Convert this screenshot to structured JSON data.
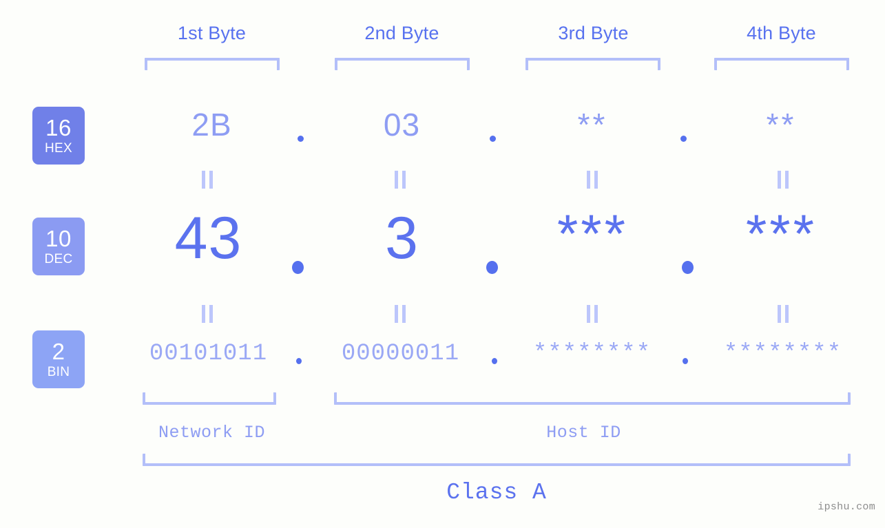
{
  "headers": [
    {
      "label": "1st Byte"
    },
    {
      "label": "2nd Byte"
    },
    {
      "label": "3rd Byte"
    },
    {
      "label": "4th Byte"
    }
  ],
  "rows": [
    {
      "base": "16",
      "base_abbr": "HEX",
      "badge_color": "#7080e8",
      "values": [
        "2B",
        "03",
        "**",
        "**"
      ],
      "separator": "."
    },
    {
      "base": "10",
      "base_abbr": "DEC",
      "badge_color": "#8b9bf2",
      "values": [
        "43",
        "3",
        "***",
        "***"
      ],
      "separator": "."
    },
    {
      "base": "2",
      "base_abbr": "BIN",
      "badge_color": "#8da4f5",
      "values": [
        "00101011",
        "00000011",
        "********",
        "********"
      ],
      "separator": "."
    }
  ],
  "equality_symbol": "||",
  "sections": {
    "network_id": "Network ID",
    "host_id": "Host ID",
    "class": "Class A"
  },
  "watermark": "ipshu.com",
  "colors": {
    "background": "#fdfefb",
    "accent_strong": "#5b72ee",
    "accent_light": "#8e9df3",
    "bracket": "#b3bff9",
    "dot": "#5570ee",
    "bin_text": "#9aa8f5",
    "watermark": "#8d8d8d"
  }
}
